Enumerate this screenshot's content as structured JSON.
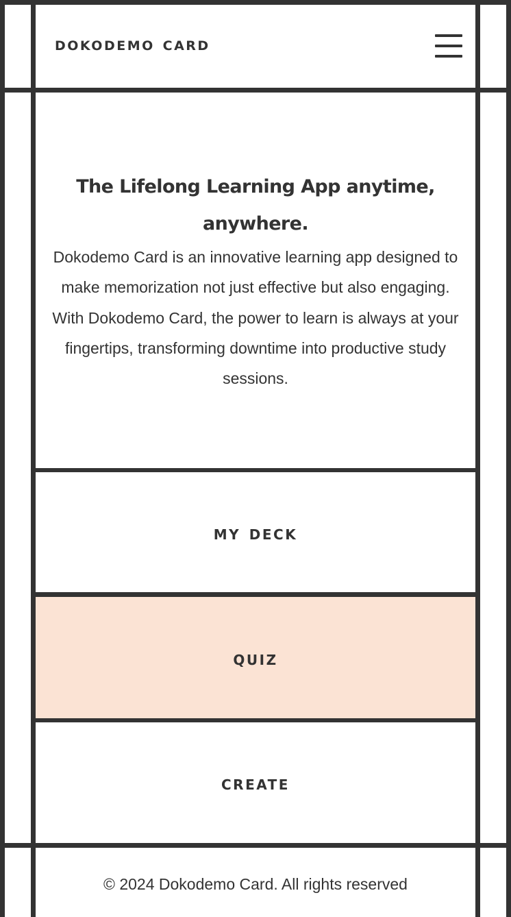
{
  "header": {
    "brand": "Dokodemo Card",
    "menu_icon": "hamburger-menu-icon"
  },
  "hero": {
    "title_line1": "The Lifelong Learning App anytime,",
    "title_line2": "anywhere.",
    "body": "Dokodemo Card is an innovative learning app designed to make memorization not just effective but also engaging. With Dokodemo Card, the power to learn is always at your fingertips, transforming downtime into productive study sessions."
  },
  "nav": {
    "my_deck": "My Deck",
    "quiz": "Quiz",
    "create": "Create"
  },
  "footer": {
    "copyright": "© 2024 Dokodemo Card. All rights reserved"
  },
  "colors": {
    "ink": "#333333",
    "background": "#ffffff",
    "quiz_highlight": "#fbe3d4"
  }
}
